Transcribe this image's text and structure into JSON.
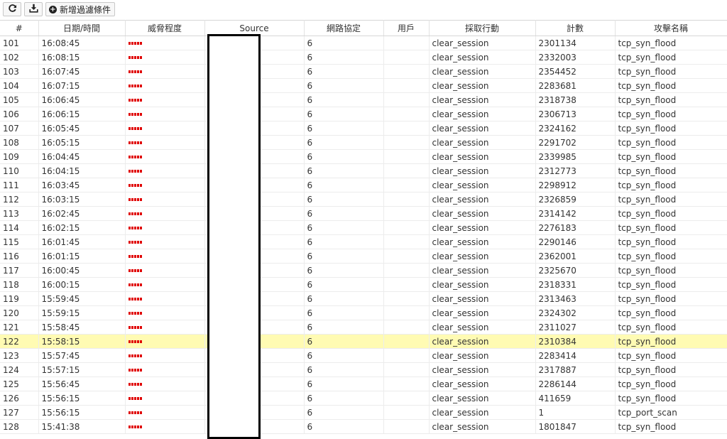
{
  "toolbar": {
    "refresh_icon": "refresh-icon",
    "download_icon": "download-icon",
    "add_filter_label": "新增過濾條件"
  },
  "colors": {
    "severity": "#e00000",
    "highlight_row": "#fffbb3",
    "link": "#2a5e99"
  },
  "columns": [
    "#",
    "日期/時間",
    "威脅程度",
    "Source",
    "網路協定",
    "用戶",
    "採取行動",
    "計數",
    "攻擊名稱"
  ],
  "rows": [
    {
      "num": "101",
      "time": "16:08:45",
      "protocol": "6",
      "user": "",
      "action": "clear_session",
      "count": "2301134",
      "attack": "tcp_syn_flood"
    },
    {
      "num": "102",
      "time": "16:08:15",
      "protocol": "6",
      "user": "",
      "action": "clear_session",
      "count": "2332003",
      "attack": "tcp_syn_flood"
    },
    {
      "num": "103",
      "time": "16:07:45",
      "protocol": "6",
      "user": "",
      "action": "clear_session",
      "count": "2354452",
      "attack": "tcp_syn_flood"
    },
    {
      "num": "104",
      "time": "16:07:15",
      "protocol": "6",
      "user": "",
      "action": "clear_session",
      "count": "2283681",
      "attack": "tcp_syn_flood"
    },
    {
      "num": "105",
      "time": "16:06:45",
      "protocol": "6",
      "user": "",
      "action": "clear_session",
      "count": "2318738",
      "attack": "tcp_syn_flood"
    },
    {
      "num": "106",
      "time": "16:06:15",
      "protocol": "6",
      "user": "",
      "action": "clear_session",
      "count": "2306713",
      "attack": "tcp_syn_flood"
    },
    {
      "num": "107",
      "time": "16:05:45",
      "protocol": "6",
      "user": "",
      "action": "clear_session",
      "count": "2324162",
      "attack": "tcp_syn_flood"
    },
    {
      "num": "108",
      "time": "16:05:15",
      "protocol": "6",
      "user": "",
      "action": "clear_session",
      "count": "2291702",
      "attack": "tcp_syn_flood"
    },
    {
      "num": "109",
      "time": "16:04:45",
      "protocol": "6",
      "user": "",
      "action": "clear_session",
      "count": "2339985",
      "attack": "tcp_syn_flood"
    },
    {
      "num": "110",
      "time": "16:04:15",
      "protocol": "6",
      "user": "",
      "action": "clear_session",
      "count": "2312773",
      "attack": "tcp_syn_flood"
    },
    {
      "num": "111",
      "time": "16:03:45",
      "protocol": "6",
      "user": "",
      "action": "clear_session",
      "count": "2298912",
      "attack": "tcp_syn_flood"
    },
    {
      "num": "112",
      "time": "16:03:15",
      "protocol": "6",
      "user": "",
      "action": "clear_session",
      "count": "2326859",
      "attack": "tcp_syn_flood"
    },
    {
      "num": "113",
      "time": "16:02:45",
      "protocol": "6",
      "user": "",
      "action": "clear_session",
      "count": "2314142",
      "attack": "tcp_syn_flood"
    },
    {
      "num": "114",
      "time": "16:02:15",
      "protocol": "6",
      "user": "",
      "action": "clear_session",
      "count": "2276183",
      "attack": "tcp_syn_flood"
    },
    {
      "num": "115",
      "time": "16:01:45",
      "protocol": "6",
      "user": "",
      "action": "clear_session",
      "count": "2290146",
      "attack": "tcp_syn_flood"
    },
    {
      "num": "116",
      "time": "16:01:15",
      "protocol": "6",
      "user": "",
      "action": "clear_session",
      "count": "2362001",
      "attack": "tcp_syn_flood"
    },
    {
      "num": "117",
      "time": "16:00:45",
      "protocol": "6",
      "user": "",
      "action": "clear_session",
      "count": "2325670",
      "attack": "tcp_syn_flood"
    },
    {
      "num": "118",
      "time": "16:00:15",
      "protocol": "6",
      "user": "",
      "action": "clear_session",
      "count": "2318331",
      "attack": "tcp_syn_flood"
    },
    {
      "num": "119",
      "time": "15:59:45",
      "protocol": "6",
      "user": "",
      "action": "clear_session",
      "count": "2313463",
      "attack": "tcp_syn_flood"
    },
    {
      "num": "120",
      "time": "15:59:15",
      "protocol": "6",
      "user": "",
      "action": "clear_session",
      "count": "2324302",
      "attack": "tcp_syn_flood"
    },
    {
      "num": "121",
      "time": "15:58:45",
      "protocol": "6",
      "user": "",
      "action": "clear_session",
      "count": "2311027",
      "attack": "tcp_syn_flood"
    },
    {
      "num": "122",
      "time": "15:58:15",
      "protocol": "6",
      "user": "",
      "action": "clear_session",
      "count": "2310384",
      "attack": "tcp_syn_flood",
      "highlight": true
    },
    {
      "num": "123",
      "time": "15:57:45",
      "protocol": "6",
      "user": "",
      "action": "clear_session",
      "count": "2283414",
      "attack": "tcp_syn_flood"
    },
    {
      "num": "124",
      "time": "15:57:15",
      "protocol": "6",
      "user": "",
      "action": "clear_session",
      "count": "2317887",
      "attack": "tcp_syn_flood"
    },
    {
      "num": "125",
      "time": "15:56:45",
      "protocol": "6",
      "user": "",
      "action": "clear_session",
      "count": "2286144",
      "attack": "tcp_syn_flood"
    },
    {
      "num": "126",
      "time": "15:56:15",
      "protocol": "6",
      "user": "",
      "action": "clear_session",
      "count": "411659",
      "attack": "tcp_syn_flood"
    },
    {
      "num": "127",
      "time": "15:56:15",
      "protocol": "6",
      "user": "",
      "action": "clear_session",
      "count": "1",
      "attack": "tcp_port_scan"
    },
    {
      "num": "128",
      "time": "15:41:38",
      "protocol": "6",
      "user": "",
      "action": "clear_session",
      "count": "1801847",
      "attack": "tcp_syn_flood"
    }
  ]
}
